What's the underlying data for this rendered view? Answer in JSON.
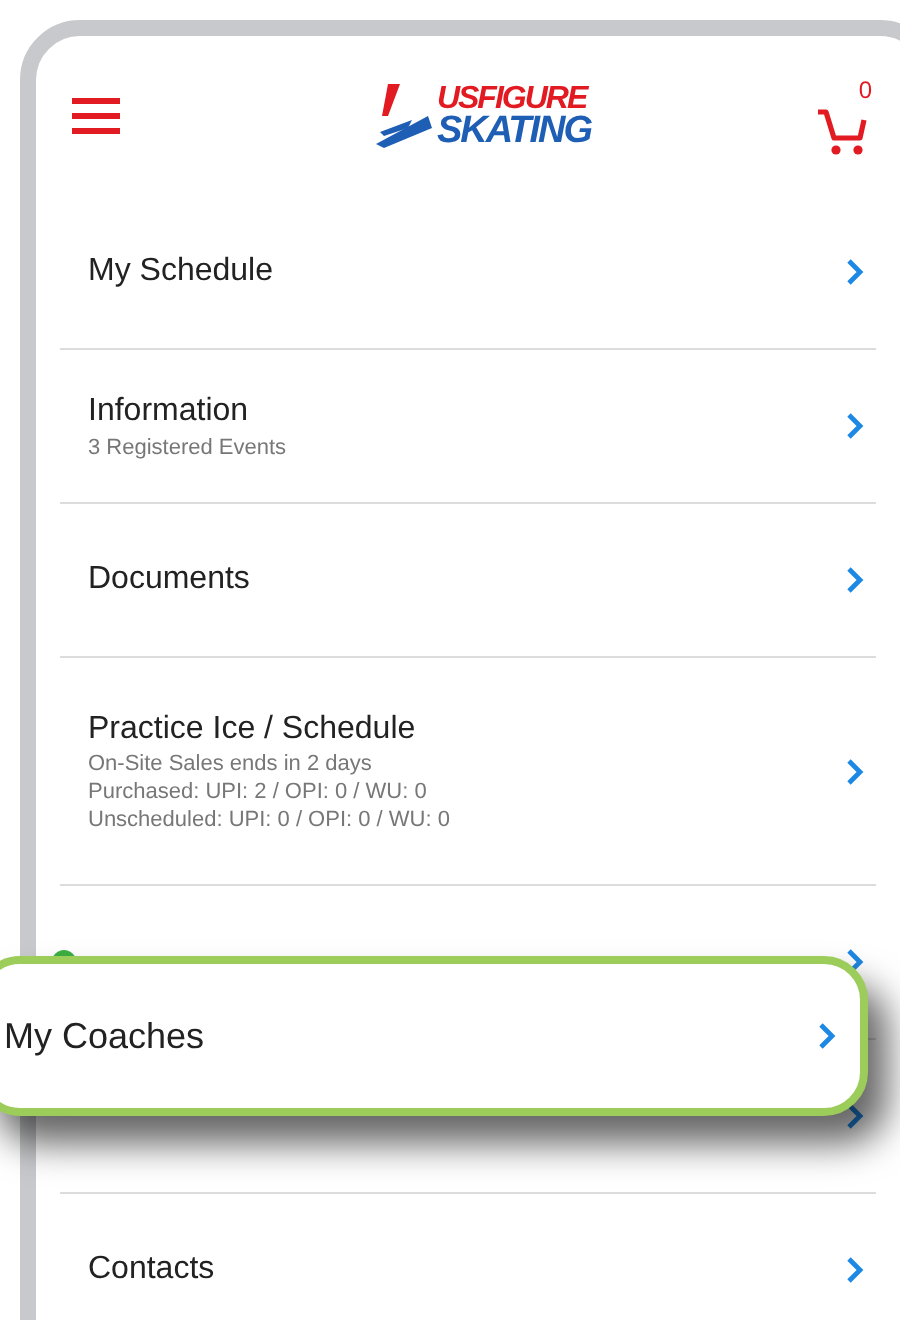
{
  "header": {
    "logo_lines": [
      "USFIGURE",
      "SKATING"
    ],
    "cart_count": "0"
  },
  "menu_items": [
    {
      "kind": "row",
      "title": "My Schedule"
    },
    {
      "kind": "row",
      "title": "Information",
      "subtitles": [
        "3 Registered Events"
      ]
    },
    {
      "kind": "row",
      "title": "Documents"
    },
    {
      "kind": "row",
      "title": "Practice Ice / Schedule",
      "subtitles": [
        "On-Site Sales ends in 2 days",
        "Purchased: UPI: 2 / OPI: 0 / WU: 0",
        "Unscheduled: UPI: 0 / OPI: 0 / WU: 0"
      ]
    },
    {
      "kind": "covered",
      "color": "#3cb043"
    },
    {
      "kind": "covered"
    },
    {
      "kind": "row",
      "title": "Contacts"
    }
  ],
  "callout": {
    "title": "My Coaches"
  }
}
